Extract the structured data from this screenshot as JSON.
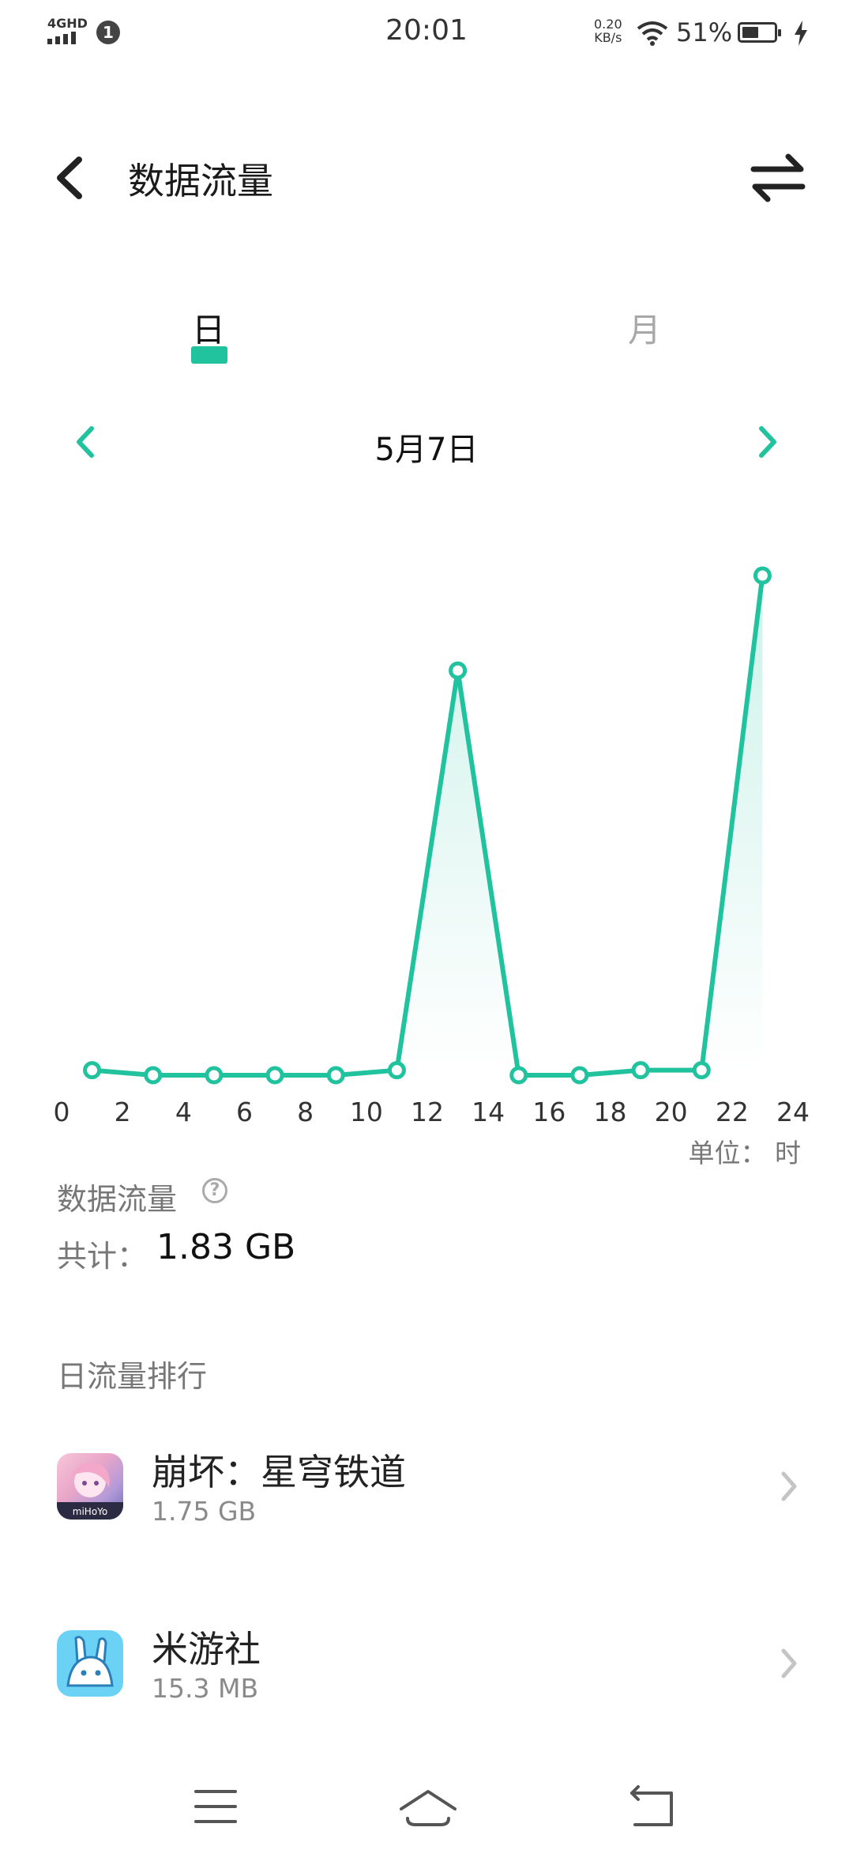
{
  "status_bar": {
    "time": "20:01",
    "network": "4GHD",
    "sim_badge": "1",
    "speed_value": "0.20",
    "speed_unit": "KB/s",
    "battery": "51%",
    "icons": [
      "signal-icon",
      "wifi-icon",
      "battery-icon",
      "charging-icon"
    ]
  },
  "header": {
    "title": "数据流量",
    "back_icon": "chevron-left-icon",
    "action_icon": "swap-icon"
  },
  "tabs": [
    {
      "label": "日",
      "selected": true
    },
    {
      "label": "月",
      "selected": false
    }
  ],
  "date_nav": {
    "label": "5月7日",
    "prev_icon": "chevron-left-icon",
    "next_icon": "chevron-right-icon"
  },
  "chart_data": {
    "type": "line",
    "x": [
      1,
      3,
      5,
      7,
      9,
      11,
      13,
      15,
      17,
      19,
      21,
      23
    ],
    "values": [
      0.01,
      0,
      0,
      0,
      0,
      0.01,
      0.81,
      0,
      0,
      0.01,
      0.01,
      1.0
    ],
    "xticks": [
      "0",
      "2",
      "4",
      "6",
      "8",
      "10",
      "12",
      "14",
      "16",
      "18",
      "20",
      "22",
      "24"
    ],
    "xlim": [
      0,
      24
    ],
    "ylim": [
      0,
      1.0
    ],
    "unit": "单位：  时",
    "grid": false,
    "color": "#21c29e"
  },
  "summary": {
    "title": "数据流量",
    "help_icon": "help-icon",
    "total_label": "共计：",
    "total_value": "1.83 GB"
  },
  "ranking": {
    "title": "日流量排行",
    "apps": [
      {
        "name": "崩坏：星穹铁道",
        "size": "1.75 GB",
        "icon": "honkai-star-rail-app-icon",
        "icon_text": "miHoYo"
      },
      {
        "name": "米游社",
        "size": "15.3 MB",
        "icon": "miyoushe-app-icon"
      }
    ]
  },
  "nav_bar": {
    "icons": [
      "menu-icon",
      "home-icon",
      "back-icon"
    ]
  }
}
